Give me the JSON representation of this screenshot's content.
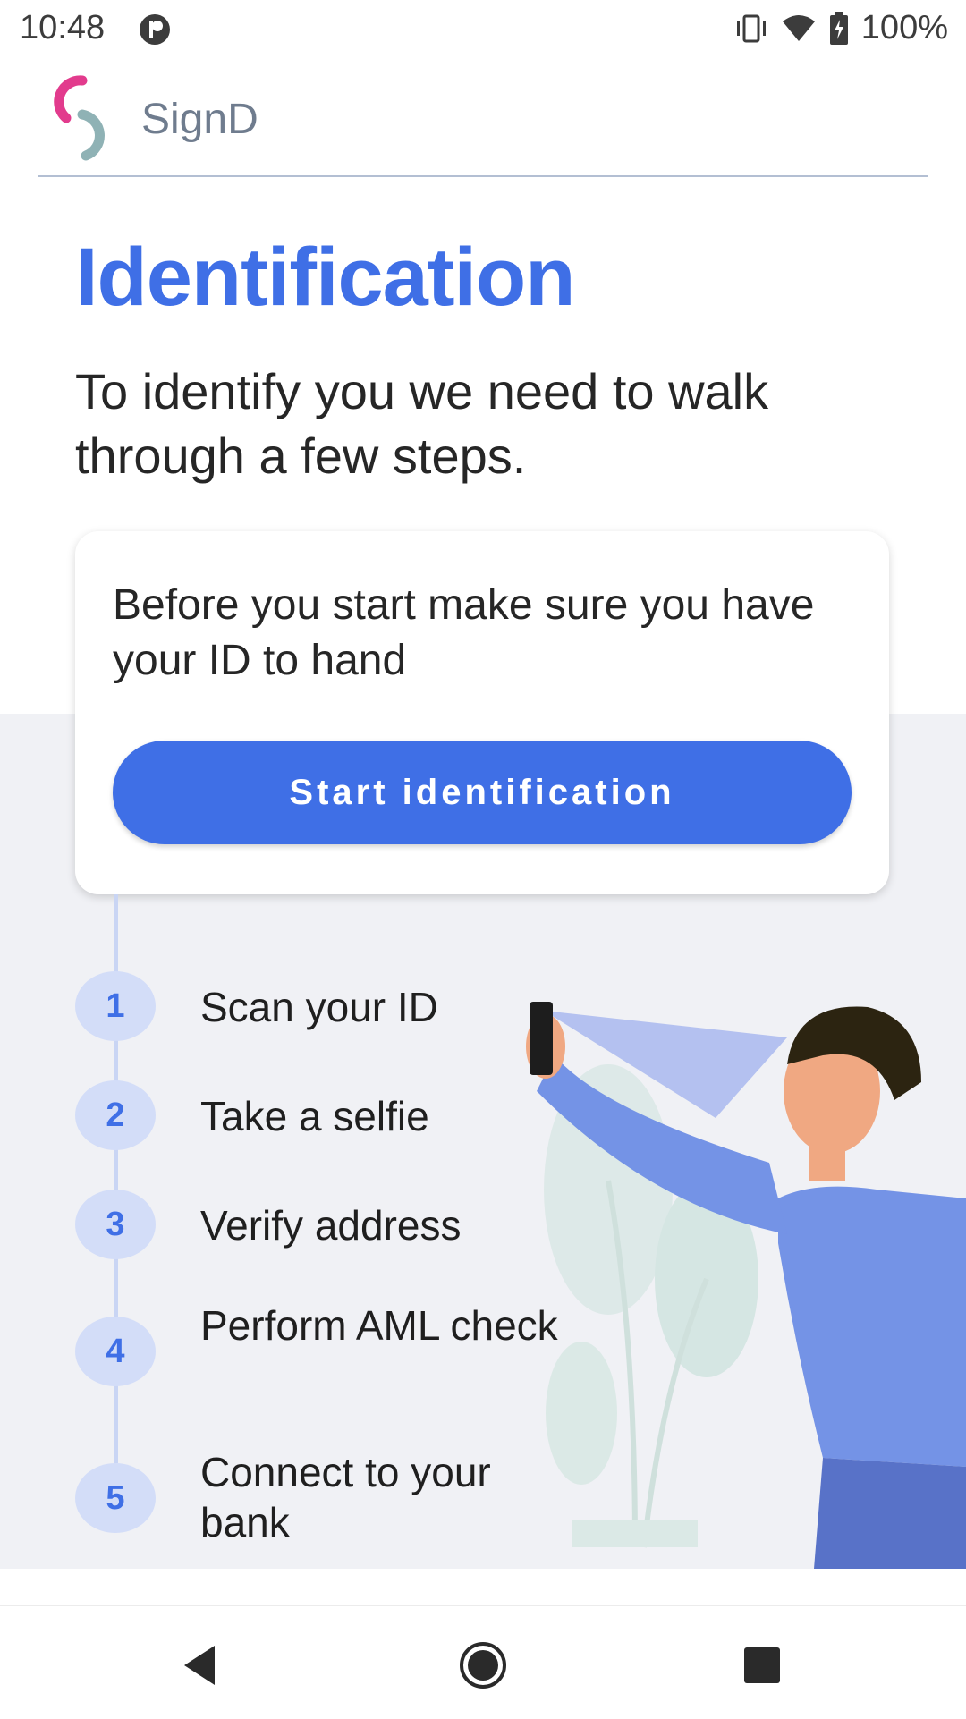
{
  "status_bar": {
    "time": "10:48",
    "battery_percent": "100%",
    "icons": [
      "app-notification-icon",
      "vibrate-icon",
      "wifi-icon",
      "battery-charging-icon"
    ]
  },
  "header": {
    "app_name": "SignD",
    "logo_colors": {
      "pink": "#e23b8d",
      "teal": "#8fb2b5"
    }
  },
  "main": {
    "title": "Identification",
    "subtitle": "To identify you we need to walk through a few steps."
  },
  "card": {
    "text": "Before you start make sure you have your ID to hand",
    "button_label": "Start identification"
  },
  "steps": [
    {
      "number": "1",
      "label": "Scan your ID"
    },
    {
      "number": "2",
      "label": "Take a selfie"
    },
    {
      "number": "3",
      "label": "Verify address"
    },
    {
      "number": "4",
      "label": "Perform AML check"
    },
    {
      "number": "5",
      "label": "Connect to your bank"
    }
  ],
  "colors": {
    "accent": "#3f6fe6",
    "panel_bg": "#f0f1f5",
    "badge_bg": "#d3ddf8"
  },
  "nav": {
    "icons": [
      "back-icon",
      "home-icon",
      "recents-icon"
    ]
  }
}
